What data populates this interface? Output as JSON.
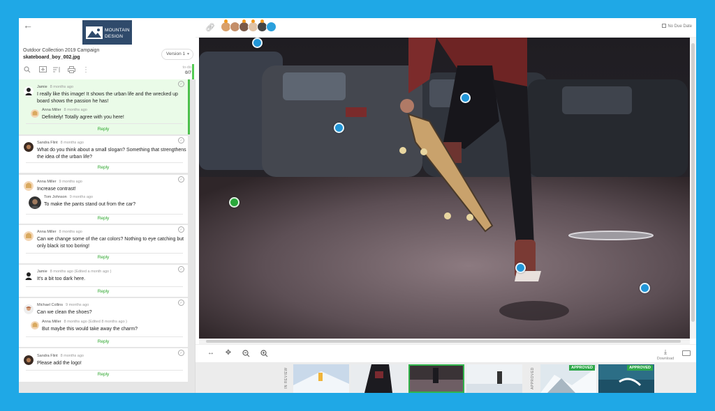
{
  "header": {
    "logo_line1": "MOUNTAIN",
    "logo_line2": "DESIGN",
    "campaign": "Outdoor Collection 2019 Campaign",
    "filename": "skateboard_boy_002.jpg",
    "version": "Version 1",
    "count_label": "to-do",
    "count_value": "0/7"
  },
  "comments": [
    {
      "author": "Jamie",
      "time": "8 months ago",
      "text": "I really like this image! It shows the urban life and the wrecked up board shows the passion he has!",
      "active": true,
      "reply": {
        "author": "Anna Miller",
        "time": "8 months ago",
        "text": "Definitely! Totally agree with you here!"
      }
    },
    {
      "author": "Sandra Flint",
      "time": "8 months ago",
      "text": "What do you think about a small slogan? Something that strengthens the idea of the urban life?"
    },
    {
      "author": "Anna Miller",
      "time": "9 months ago",
      "text": "Increase contrast!",
      "reply": {
        "author": "Tom Johnson",
        "time": "9 months ago",
        "text": "To make the pants stand out from the car?"
      }
    },
    {
      "author": "Anna Miller",
      "time": "8 months ago",
      "text": "Can we change some of the car colors? Nothing to eye catching but only black ist too boring!"
    },
    {
      "author": "Jamie",
      "time": "8 months ago (Edited a month ago )",
      "text": "It's a bit too dark here."
    },
    {
      "author": "Michael Collins",
      "time": "9 months ago",
      "text": "Can we clean the shoes?",
      "reply": {
        "author": "Anna Miller",
        "time": "8 months ago (Edited 8 months ago )",
        "text": "But maybe this would take away the charm?"
      }
    },
    {
      "author": "Sandra Flint",
      "time": "8 months ago",
      "text": "Please add the logo!"
    }
  ],
  "reply_label": "Reply",
  "topbar": {
    "due": "No Due Date"
  },
  "toolbar": {
    "download_label": "Download"
  },
  "filmstrip": {
    "in_review_label": "IN REVIEW",
    "approved_label": "APPROVED",
    "badge": "APPROVED"
  },
  "colors": {
    "accent": "#1fa8e6",
    "pin": "#2196d8",
    "active_pin": "#29a83a",
    "approved": "#2ea84a"
  }
}
